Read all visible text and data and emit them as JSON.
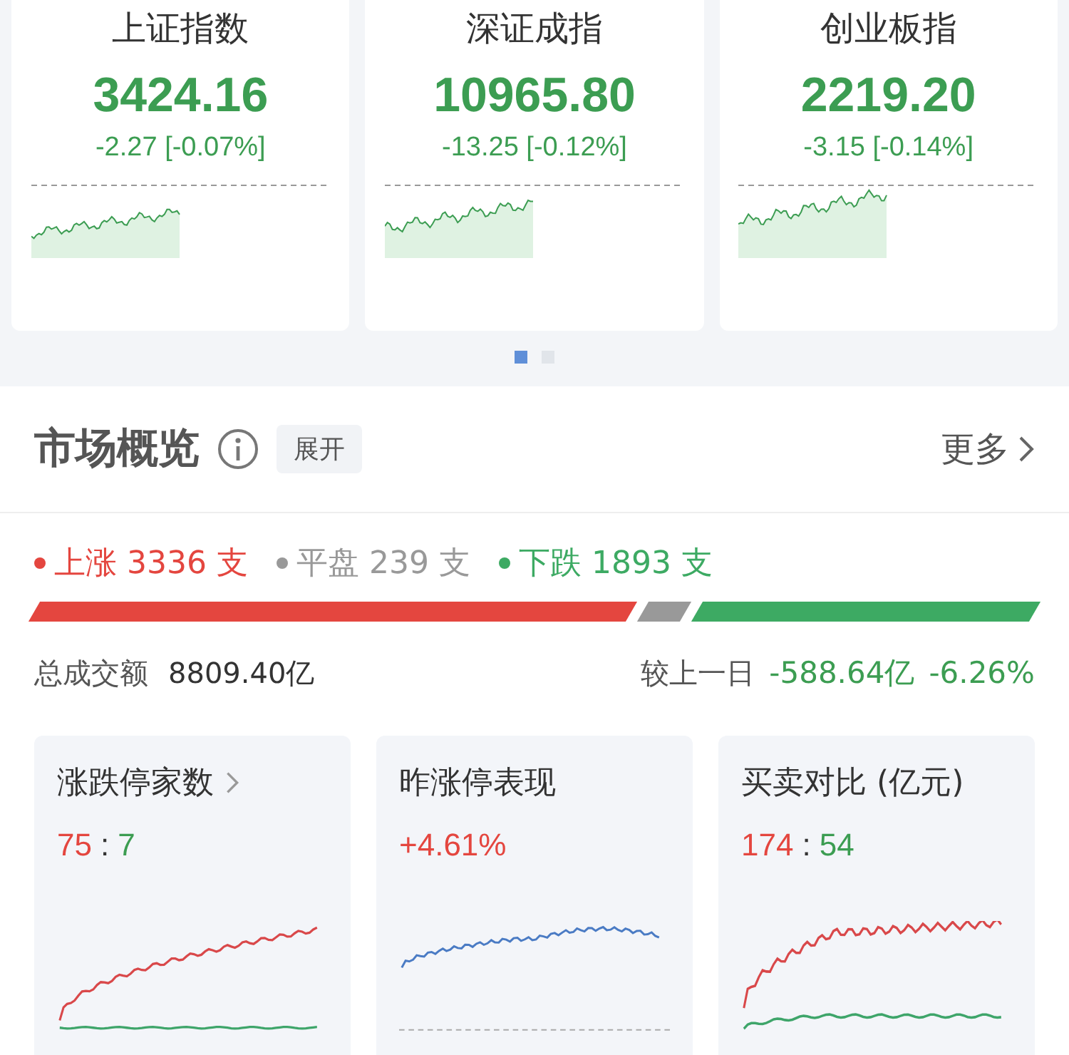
{
  "indices": [
    {
      "name": "上证指数",
      "value": "3424.16",
      "change": "-2.27 [-0.07%]",
      "color": "#3c9d52"
    },
    {
      "name": "深证成指",
      "value": "10965.80",
      "change": "-13.25 [-0.12%]",
      "color": "#3c9d52"
    },
    {
      "name": "创业板指",
      "value": "2219.20",
      "change": "-3.15 [-0.14%]",
      "color": "#3c9d52"
    }
  ],
  "pager": [
    {
      "selected": true
    },
    {
      "selected": false
    }
  ],
  "overview": {
    "title": "市场概览",
    "expand": "展开",
    "more": "更多",
    "breadth": [
      {
        "label": "上涨",
        "count": "3336",
        "unit": "支",
        "color": "#e4463f"
      },
      {
        "label": "平盘",
        "count": "239",
        "unit": "支",
        "color": "#999999"
      },
      {
        "label": "下跌",
        "count": "1893",
        "unit": "支",
        "color": "#3daa63"
      }
    ],
    "turnover_label": "总成交额",
    "turnover": "8809.40亿",
    "compare_label": "较上一日",
    "compare_amount": "-588.64亿",
    "compare_pct": "-6.26%"
  },
  "mini_cards": [
    {
      "title": "涨跌停家数",
      "chevron": true,
      "values": [
        {
          "text": "75",
          "color": "#e4463f"
        },
        {
          "text": ":",
          "color": "#333333"
        },
        {
          "text": "7",
          "color": "#3c9d52"
        }
      ]
    },
    {
      "title": "昨涨停表现",
      "chevron": false,
      "values": [
        {
          "text": "+4.61%",
          "color": "#e4463f"
        }
      ]
    },
    {
      "title": "买卖对比 (亿元)",
      "chevron": false,
      "values": [
        {
          "text": "174",
          "color": "#e4463f"
        },
        {
          "text": ":",
          "color": "#333333"
        },
        {
          "text": "54",
          "color": "#3c9d52"
        }
      ]
    }
  ]
}
